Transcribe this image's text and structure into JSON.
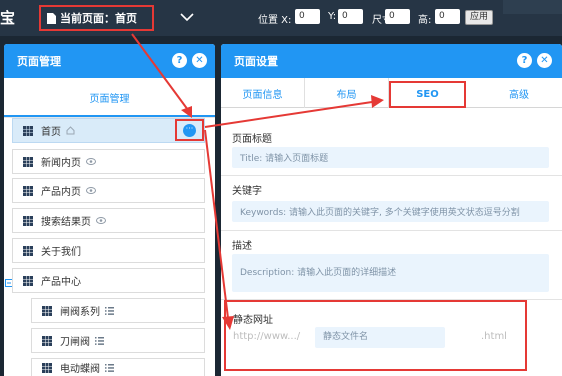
{
  "topbar": {
    "logo_fragment": "宝",
    "current_page_label": "当前页面：首页",
    "pos_x_label": "位置 X:",
    "pos_x_value": "0",
    "pos_y_label": "Y:",
    "pos_y_value": "0",
    "size_width_label": "尺寸 宽:",
    "size_width_value": "0",
    "size_height_label": "高:",
    "size_height_value": "0",
    "apply_label": "应用"
  },
  "page_manager": {
    "title": "页面管理",
    "help_label": "?",
    "close_label": "✕",
    "tab_label": "页面管理",
    "more_label": "···",
    "items": [
      {
        "label": "首页",
        "icon": "home-icon"
      },
      {
        "label": "新闻内页",
        "icon": "eye-icon"
      },
      {
        "label": "产品内页",
        "icon": "eye-icon"
      },
      {
        "label": "搜索结果页",
        "icon": "eye-icon"
      },
      {
        "label": "关于我们",
        "icon": ""
      },
      {
        "label": "产品中心",
        "icon": ""
      },
      {
        "label": "闸阀系列",
        "icon": "list-icon"
      },
      {
        "label": "刀闸阀",
        "icon": "list-icon"
      },
      {
        "label": "电动蝶阀",
        "icon": "list-icon"
      }
    ]
  },
  "page_settings": {
    "title": "页面设置",
    "help_label": "?",
    "close_label": "✕",
    "tabs": [
      "页面信息",
      "布局",
      "SEO",
      "高级"
    ],
    "active_tab": "SEO",
    "page_title_label": "页面标题",
    "page_title_placeholder": "Title: 请输入页面标题",
    "keywords_label": "关键字",
    "keywords_placeholder": "Keywords: 请输入此页面的关键字, 多个关键字使用英文状态逗号分割",
    "description_label": "描述",
    "description_placeholder": "Description: 请输入此页面的详细描述",
    "static_url_label": "静态网址",
    "static_url_prefix": "http://www.../",
    "static_url_placeholder": "静态文件名",
    "static_url_suffix": ".html"
  },
  "colors": {
    "accent": "#2196f3",
    "highlight": "#e53935",
    "toolbar": "#263545"
  }
}
